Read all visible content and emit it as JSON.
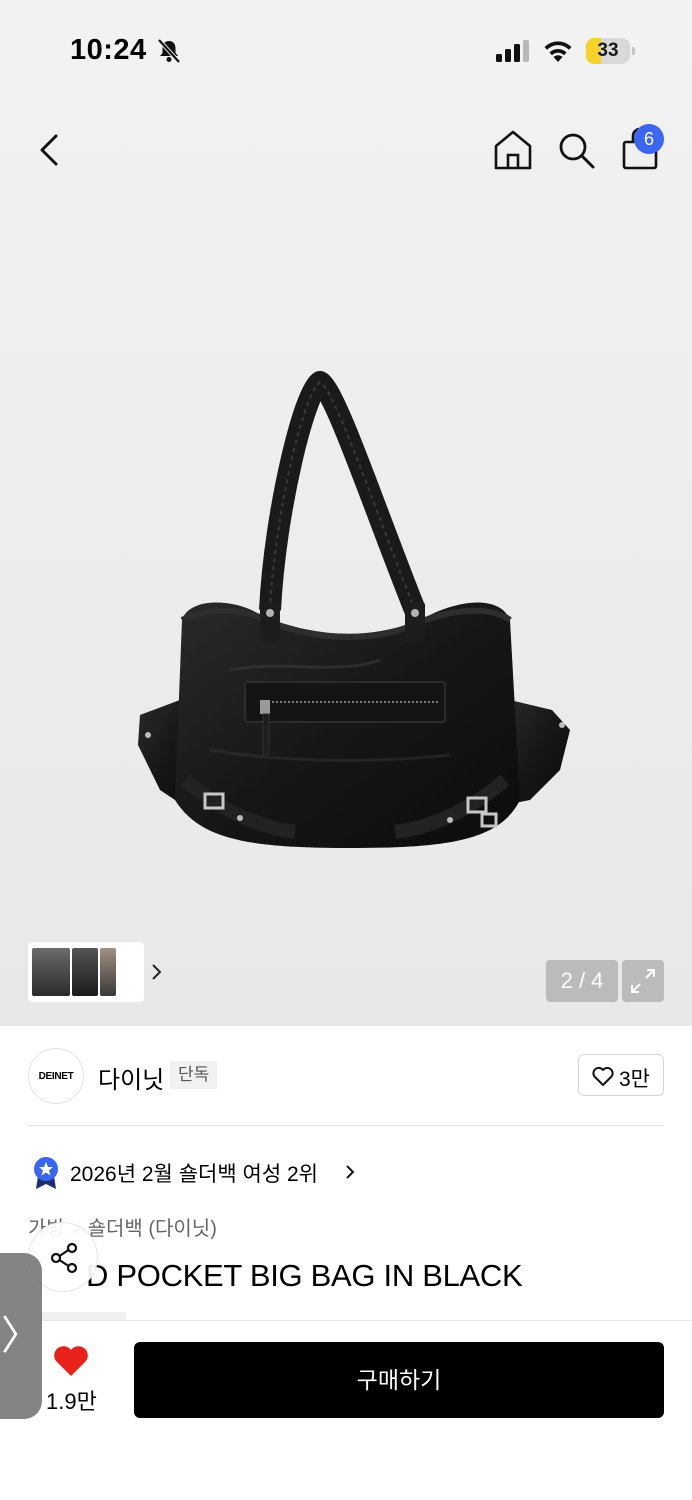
{
  "status_bar": {
    "time": "10:24",
    "battery": "33",
    "battery_level": 0.33
  },
  "nav": {
    "cart_count": "6"
  },
  "gallery": {
    "page_indicator": "2 / 4"
  },
  "brand": {
    "logo_text": "DEINET",
    "name": "다이닛",
    "tag": "단독",
    "likes": "3만"
  },
  "ranking": {
    "text": "2026년 2월 숄더백 여성 2위"
  },
  "breadcrumb": "가방 > 숄더백 (다이닛)",
  "product": {
    "title": "D POCKET BIG BAG IN BLACK"
  },
  "bottom_bar": {
    "wish_count": "1.9만",
    "buy_label": "구매하기"
  },
  "side_tab": {
    "glyph": "〉"
  },
  "colors": {
    "accent_blue": "#3a66f0",
    "battery_yellow": "#f7d32a",
    "wish_red": "#e8211c",
    "buy_button": "#000000"
  }
}
